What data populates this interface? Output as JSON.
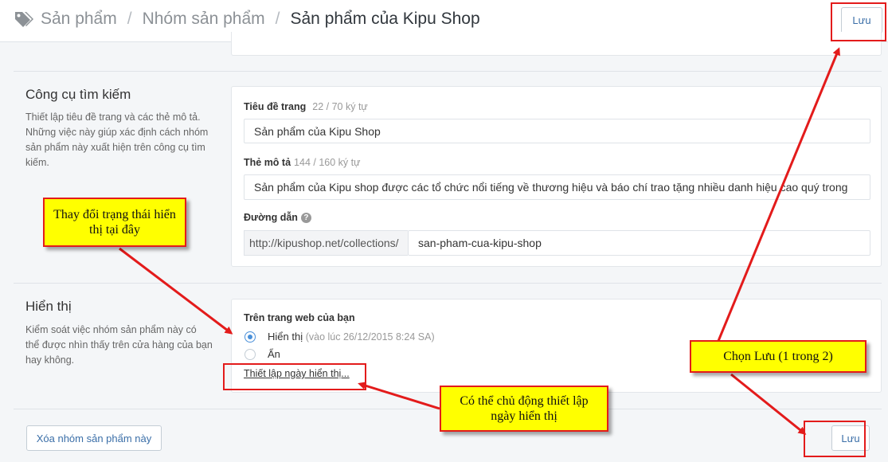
{
  "header": {
    "breadcrumb": [
      "Sản phẩm",
      "Nhóm sản phẩm"
    ],
    "separator": "/",
    "current": "Sản phẩm của Kipu Shop",
    "save_label": "Lưu"
  },
  "seo": {
    "title": "Công cụ tìm kiếm",
    "description": "Thiết lập tiêu đề trang và các thẻ mô tả. Những việc này giúp xác định cách nhóm sản phẩm này xuất hiện trên công cụ tìm kiếm.",
    "page_title_label": "Tiêu đề trang",
    "page_title_count": "22 / 70 ký tự",
    "page_title_value": "Sản phẩm của Kipu Shop",
    "meta_label": "Thẻ mô tả",
    "meta_count": "144 / 160 ký tự",
    "meta_value": "Sản phẩm của Kipu shop được các tổ chức nổi tiếng về thương hiệu và báo chí trao tặng nhiều danh hiệu cao quý trong",
    "url_label": "Đường dẫn",
    "url_prefix": "http://kipushop.net/collections/",
    "url_handle": "san-pham-cua-kipu-shop",
    "help_symbol": "?"
  },
  "visibility": {
    "title": "Hiển thị",
    "description": "Kiểm soát việc nhóm sản phẩm này có thể được nhìn thấy trên cửa hàng của bạn hay không.",
    "group_label": "Trên trang web của bạn",
    "visible_label": "Hiển thị",
    "visible_note": "(vào lúc 26/12/2015 8:24 SA)",
    "hidden_label": "Ẩn",
    "schedule_link": "Thiết lập ngày hiển thị...",
    "selected": "visible"
  },
  "footer": {
    "delete_label": "Xóa nhóm sản phẩm này",
    "save_label": "Lưu"
  },
  "annotations": {
    "change_status": "Thay đổi trạng thái hiển thị tại đây",
    "choose_save": "Chọn Lưu (1 trong 2)",
    "schedule": "Có thể chủ động thiết lập ngày hiển thị"
  },
  "colors": {
    "accent": "#4a90d9",
    "annotation_fill": "#ffff00",
    "annotation_border": "#e31b1b"
  }
}
